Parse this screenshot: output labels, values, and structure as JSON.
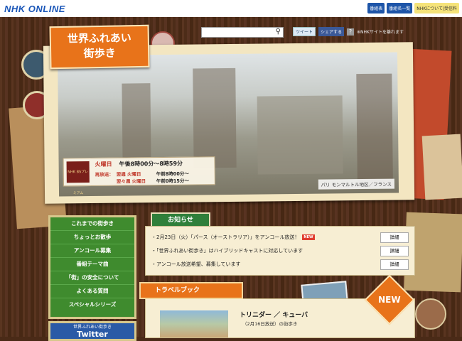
{
  "header": {
    "logo": "NHK ONLINE",
    "links": [
      "番組表",
      "番組名一覧",
      "NHKについて|受信料"
    ]
  },
  "search": {
    "placeholder": ""
  },
  "social": {
    "tweet": "ツイート",
    "share": "シェアする",
    "help": "?",
    "external_note": "※NHKサイトを離れます"
  },
  "title": "世界ふれあい\n街歩き",
  "schedule": {
    "logo_text": "NHK BSプレミアム",
    "day": "火曜日",
    "time": "午後8時00分〜8時59分",
    "rerun_label": "再放送：",
    "rerun1_day": "翌週 火曜日",
    "rerun1_time": "午前8時00分〜",
    "rerun2_day": "翌々週 火曜日",
    "rerun2_time": "午前0時15分〜"
  },
  "photo_caption": "パリ モンマルトル地区／フランス",
  "sidenav": {
    "items": [
      "これまでの街歩き",
      "ちょっとお散歩",
      "アンコール募集",
      "番組テーマ曲",
      "「街」の安全について",
      "よくある質問",
      "スペシャルシリーズ"
    ]
  },
  "twitter": {
    "line1": "世界ふれあい街歩き",
    "line2": "Twitter"
  },
  "notice": {
    "title": "お知らせ",
    "items": [
      {
        "text": "・2月23日（火）「パース（オーストラリア）」をアンコール放送！",
        "badge": "NEW",
        "button": "詳細"
      },
      {
        "text": "・「世界ふれあい街歩き」はハイブリッドキャストに対応しています",
        "badge": "",
        "button": "詳細"
      },
      {
        "text": "・アンコール放送希望、募集しています",
        "badge": "",
        "button": "詳細"
      }
    ]
  },
  "travel": {
    "title": "トラベルブック",
    "item_title": "トリニダー ／ キューバ",
    "item_sub": "（2月16日放送）の街歩き",
    "new_badge": "NEW"
  },
  "colors": {
    "accent_orange": "#e8731a",
    "nav_green": "#3f8b2e",
    "nhk_blue": "#1a56b8"
  }
}
